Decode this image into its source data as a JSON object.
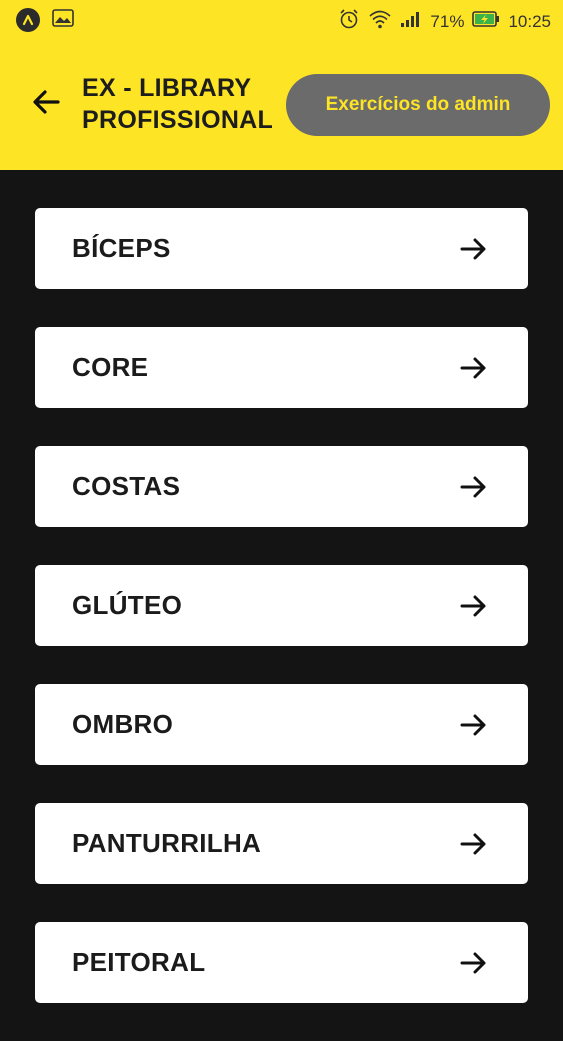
{
  "status_bar": {
    "battery": "71%",
    "time": "10:25",
    "icons": [
      "app-badge-icon",
      "image-icon",
      "alarm-icon",
      "wifi-icon",
      "signal-icon",
      "battery-charging-icon"
    ]
  },
  "header": {
    "title_line1": "EX - LIBRARY",
    "title_line2": "PROFISSIONAL",
    "admin_button": "Exercícios do admin",
    "back_icon": "arrow-left-icon"
  },
  "categories": [
    {
      "label": "BÍCEPS"
    },
    {
      "label": "CORE"
    },
    {
      "label": "COSTAS"
    },
    {
      "label": "GLÚTEO"
    },
    {
      "label": "OMBRO"
    },
    {
      "label": "PANTURRILHA"
    },
    {
      "label": "PEITORAL"
    }
  ],
  "colors": {
    "accent_yellow": "#fde425",
    "background": "#141414",
    "button_gray": "#6b6b6b",
    "card": "#ffffff"
  }
}
